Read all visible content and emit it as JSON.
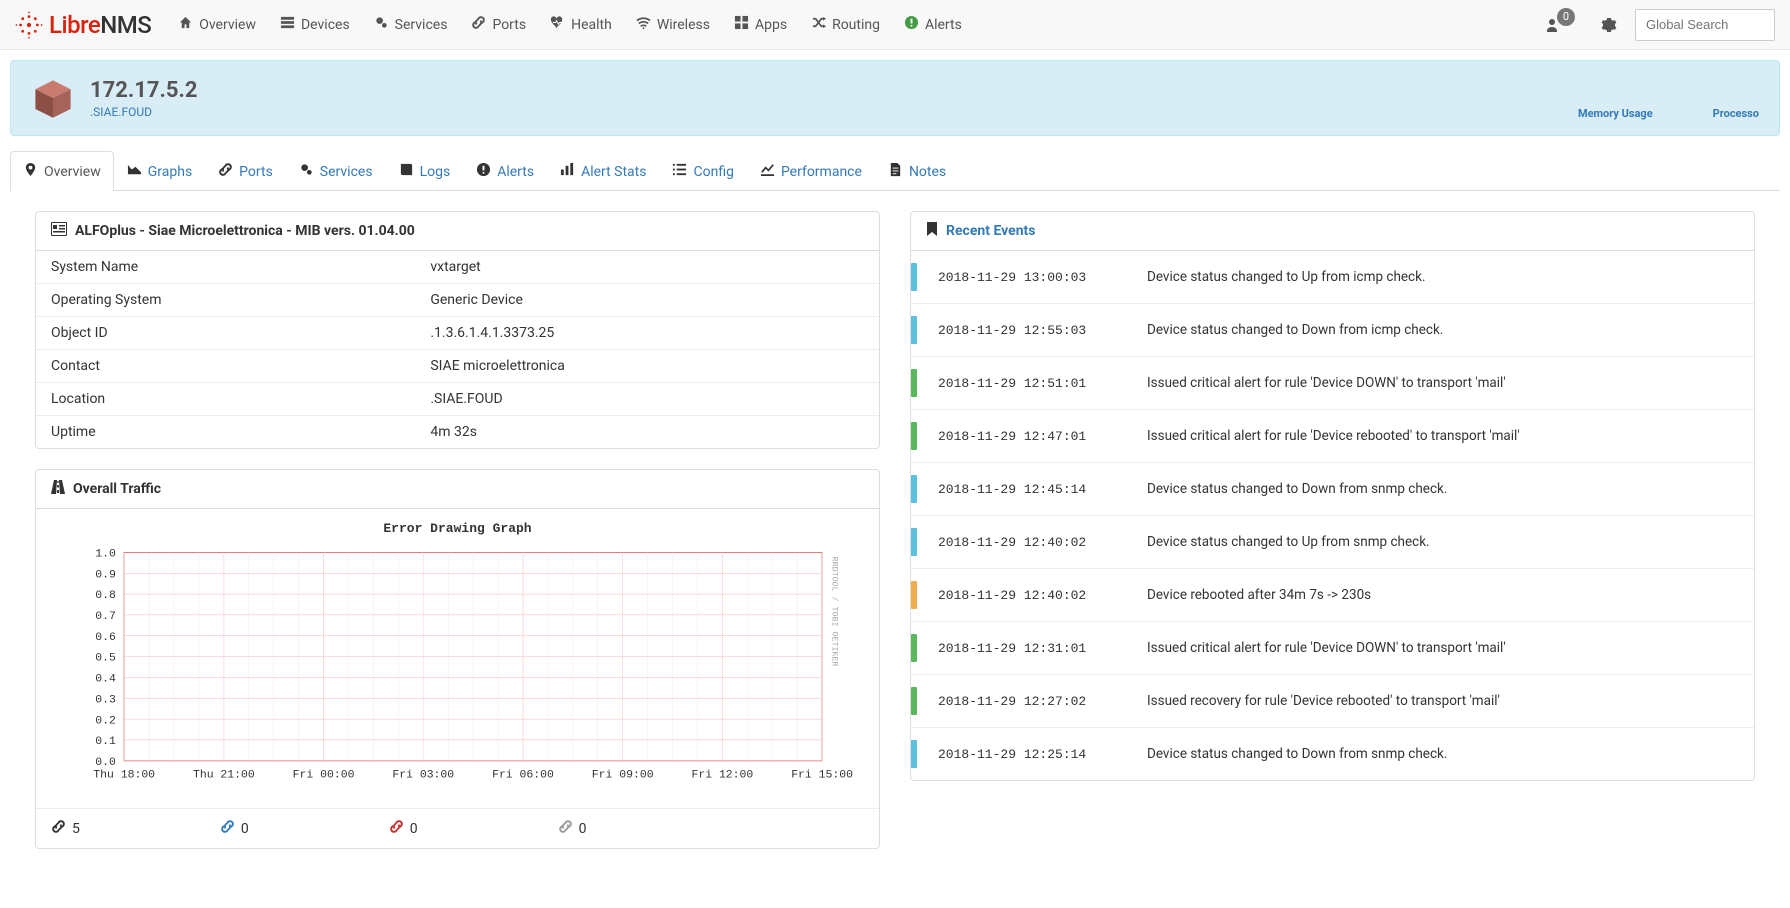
{
  "brand": {
    "libre": "Libre",
    "nms": "NMS"
  },
  "search": {
    "placeholder": "Global Search"
  },
  "nav": [
    {
      "label": "Overview",
      "icon": "home"
    },
    {
      "label": "Devices",
      "icon": "server-stack"
    },
    {
      "label": "Services",
      "icon": "cogs"
    },
    {
      "label": "Ports",
      "icon": "link"
    },
    {
      "label": "Health",
      "icon": "heartbeat"
    },
    {
      "label": "Wireless",
      "icon": "wifi"
    },
    {
      "label": "Apps",
      "icon": "th-large"
    },
    {
      "label": "Routing",
      "icon": "random"
    },
    {
      "label": "Alerts",
      "icon": "exclamation-circle"
    }
  ],
  "user_badge": "0",
  "device": {
    "title": "172.17.5.2",
    "sub": ".SIAE.FOUD",
    "right_links": [
      "Memory Usage",
      "Processo"
    ]
  },
  "tabs": [
    {
      "label": "Overview",
      "icon": "map-marker",
      "active": true
    },
    {
      "label": "Graphs",
      "icon": "area-chart"
    },
    {
      "label": "Ports",
      "icon": "link"
    },
    {
      "label": "Services",
      "icon": "cogs"
    },
    {
      "label": "Logs",
      "icon": "book"
    },
    {
      "label": "Alerts",
      "icon": "exclamation-circle"
    },
    {
      "label": "Alert Stats",
      "icon": "bar-chart"
    },
    {
      "label": "Config",
      "icon": "list"
    },
    {
      "label": "Performance",
      "icon": "line-chart"
    },
    {
      "label": "Notes",
      "icon": "file-text"
    }
  ],
  "info_panel": {
    "heading": "ALFOplus - Siae Microelettronica - MIB vers. 01.04.00",
    "rows": [
      {
        "k": "System Name",
        "v": "vxtarget"
      },
      {
        "k": "Operating System",
        "v": "Generic Device"
      },
      {
        "k": "Object ID",
        "v": ".1.3.6.1.4.1.3373.25"
      },
      {
        "k": "Contact",
        "v": "SIAE microelettronica"
      },
      {
        "k": "Location",
        "v": ".SIAE.FOUD"
      },
      {
        "k": "Uptime",
        "v": "4m 32s"
      }
    ]
  },
  "traffic": {
    "heading": "Overall Traffic",
    "graph_title": "Error Drawing Graph",
    "watermark": "RRDTOOL / TOBI OETIKER"
  },
  "port_counts": [
    {
      "color": "black",
      "value": "5"
    },
    {
      "color": "blue",
      "value": "0"
    },
    {
      "color": "red",
      "value": "0"
    },
    {
      "color": "grey",
      "value": "0"
    }
  ],
  "events": {
    "heading": "Recent Events",
    "items": [
      {
        "time": "2018-11-29 13:00:03",
        "msg": "Device status changed to Up from icmp check.",
        "color": "#5bc0de"
      },
      {
        "time": "2018-11-29 12:55:03",
        "msg": "Device status changed to Down from icmp check.",
        "color": "#5bc0de"
      },
      {
        "time": "2018-11-29 12:51:01",
        "msg": "Issued critical alert for rule 'Device DOWN' to transport 'mail'",
        "color": "#5cb85c"
      },
      {
        "time": "2018-11-29 12:47:01",
        "msg": "Issued critical alert for rule 'Device rebooted' to transport 'mail'",
        "color": "#5cb85c"
      },
      {
        "time": "2018-11-29 12:45:14",
        "msg": "Device status changed to Down from snmp check.",
        "color": "#5bc0de"
      },
      {
        "time": "2018-11-29 12:40:02",
        "msg": "Device status changed to Up from snmp check.",
        "color": "#5bc0de"
      },
      {
        "time": "2018-11-29 12:40:02",
        "msg": "Device rebooted after 34m 7s -> 230s",
        "color": "#f0ad4e"
      },
      {
        "time": "2018-11-29 12:31:01",
        "msg": "Issued critical alert for rule 'Device DOWN' to transport 'mail'",
        "color": "#5cb85c"
      },
      {
        "time": "2018-11-29 12:27:02",
        "msg": "Issued recovery for rule 'Device rebooted' to transport 'mail'",
        "color": "#5cb85c"
      },
      {
        "time": "2018-11-29 12:25:14",
        "msg": "Device status changed to Down from snmp check.",
        "color": "#5bc0de"
      }
    ]
  },
  "chart_data": {
    "type": "line",
    "title": "Error Drawing Graph",
    "xlabel": "",
    "ylabel": "",
    "ylim": [
      0.0,
      1.0
    ],
    "y_ticks": [
      0.0,
      0.1,
      0.2,
      0.3,
      0.4,
      0.5,
      0.6,
      0.7,
      0.8,
      0.9,
      1.0
    ],
    "x_ticks": [
      "Thu 18:00",
      "Thu 21:00",
      "Fri 00:00",
      "Fri 03:00",
      "Fri 06:00",
      "Fri 09:00",
      "Fri 12:00",
      "Fri 15:00"
    ],
    "series": []
  }
}
